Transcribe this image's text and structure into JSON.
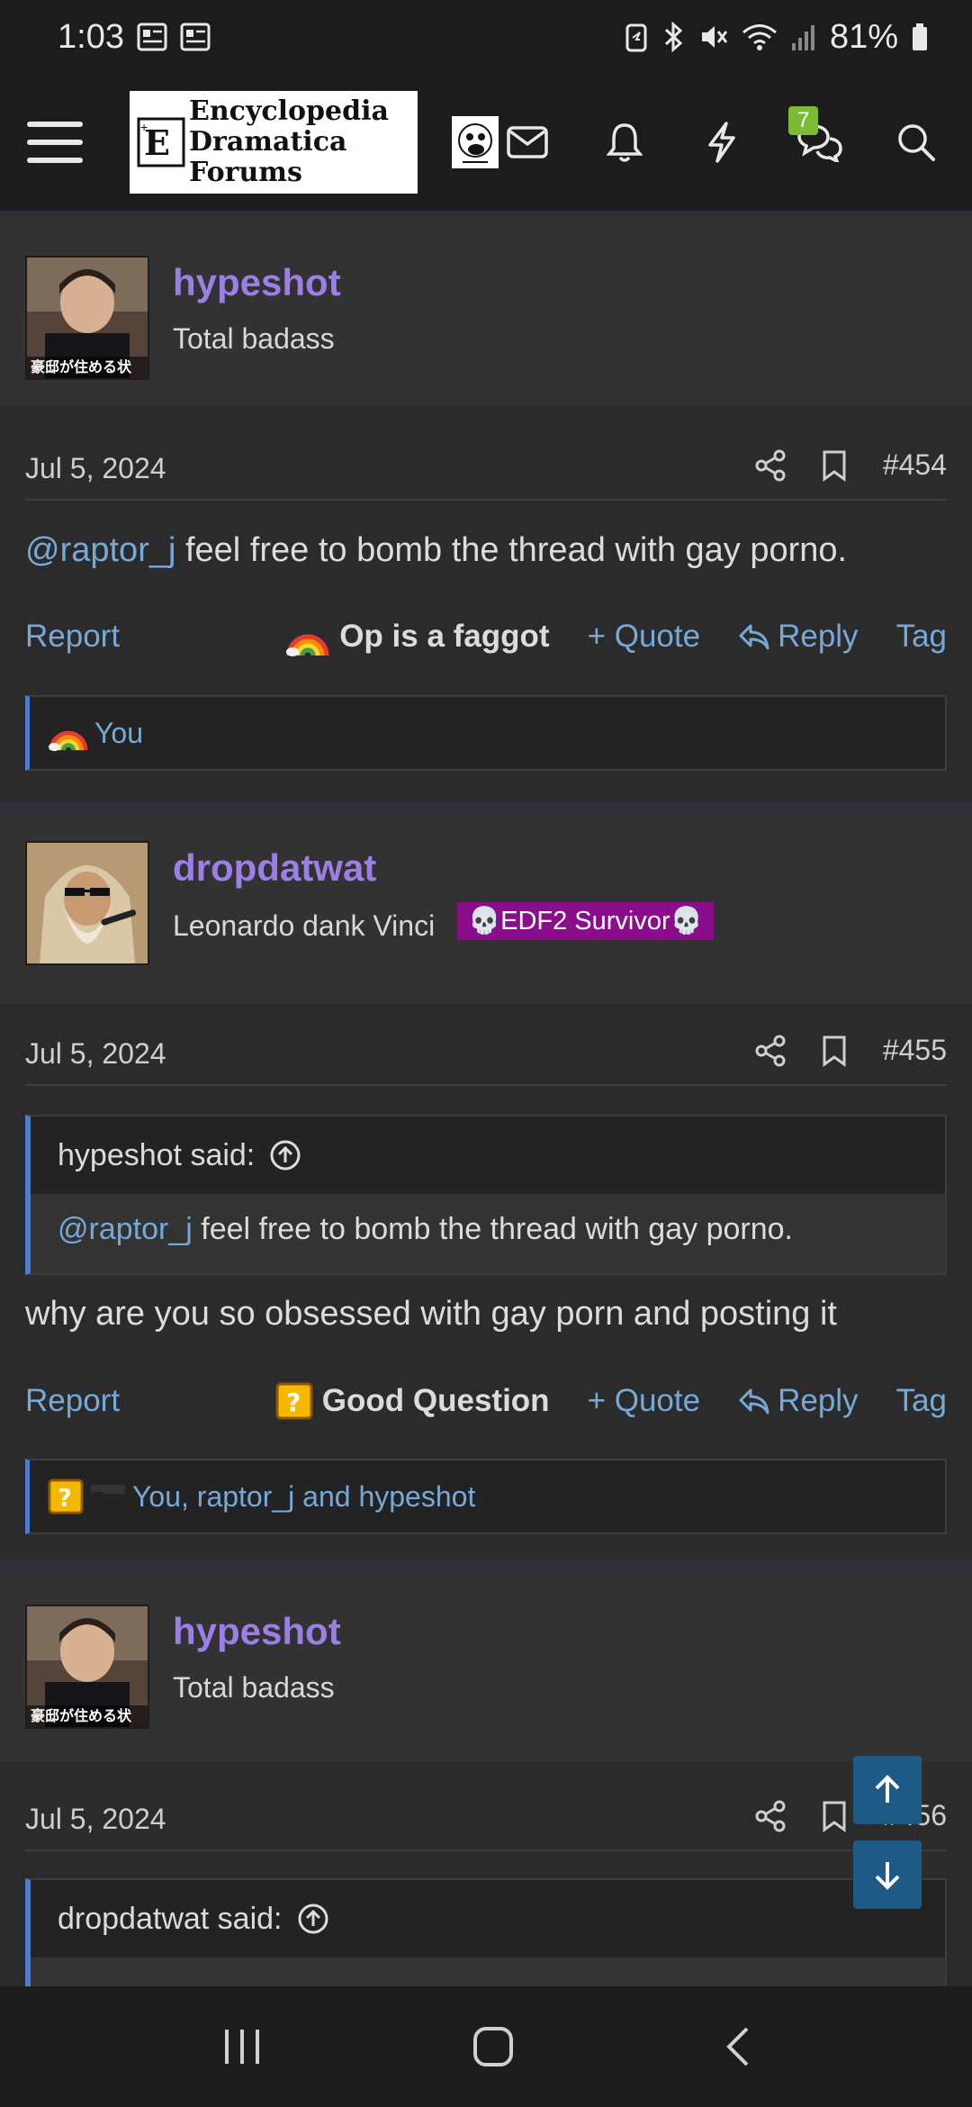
{
  "status_bar": {
    "time": "1:03",
    "battery": "81%"
  },
  "header": {
    "logo_line1": "Encyclopedia",
    "logo_line2": "Dramatica Forums",
    "conversations_badge": "7",
    "icons": [
      "menu-icon",
      "mail-icon",
      "bell-icon",
      "lightning-icon",
      "conversations-icon",
      "search-icon"
    ]
  },
  "posts": [
    {
      "username": "hypeshot",
      "user_title": "Total badass",
      "avatar_caption": "豪邸が住める状",
      "date": "Jul 5, 2024",
      "number": "#454",
      "mention": "@raptor_j",
      "message": " feel free to bomb the thread with gay porno.",
      "report": "Report",
      "reaction_label": "Op is a faggot",
      "quote": "+ Quote",
      "reply": "Reply",
      "tag": "Tag",
      "reactions_by": "You"
    },
    {
      "username": "dropdatwat",
      "user_title": "Leonardo dank Vinci",
      "banner": "💀EDF2 Survivor💀",
      "date": "Jul 5, 2024",
      "number": "#455",
      "quote_author": "hypeshot said:",
      "quote_mention": "@raptor_j",
      "quote_text": " feel free to bomb the thread with gay porno.",
      "message": "why are you so obsessed with gay porn and posting it",
      "report": "Report",
      "reaction_label": "Good Question",
      "quote": "+ Quote",
      "reply": "Reply",
      "tag": "Tag",
      "reactions_by": "You, raptor_j and hypeshot"
    },
    {
      "username": "hypeshot",
      "user_title": "Total badass",
      "avatar_caption": "豪邸が住める状",
      "date": "Jul 5, 2024",
      "number": "#456",
      "quote_author": "dropdatwat said:"
    }
  ],
  "colors": {
    "username": "#9b7ee6",
    "link": "#76a8d8",
    "banner": "#8a0e8c",
    "quote_border": "#4a7ed6",
    "badge": "#7cbc35"
  }
}
